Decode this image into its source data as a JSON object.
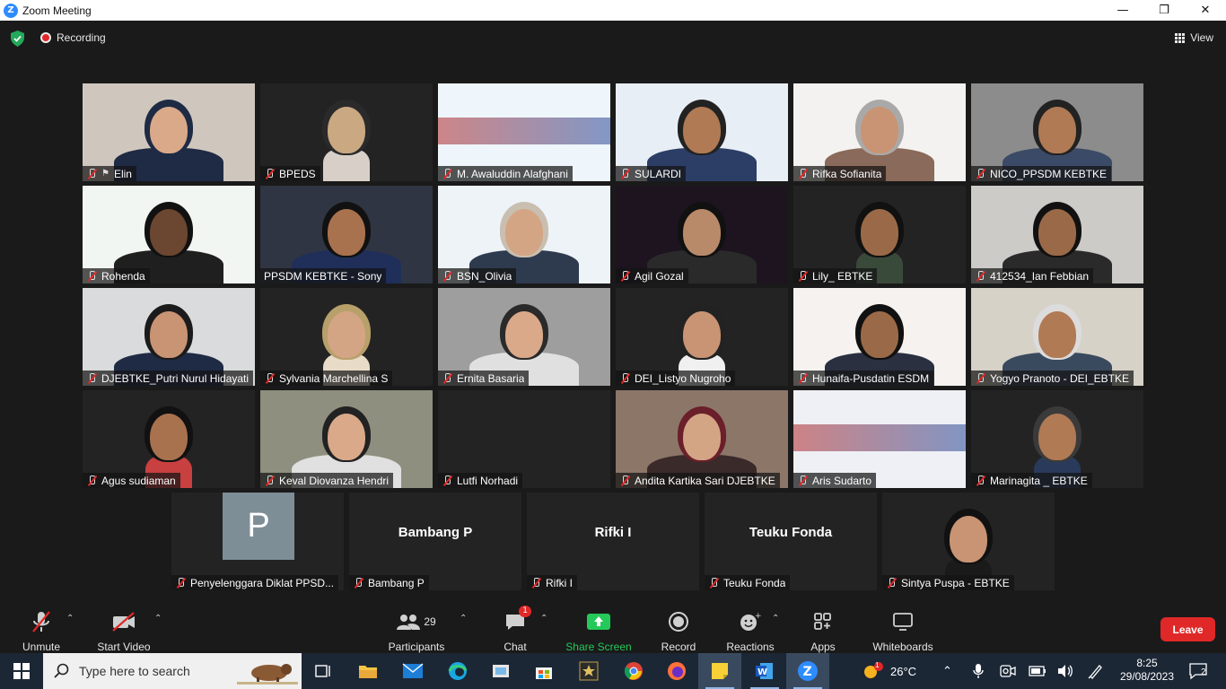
{
  "window": {
    "title": "Zoom Meeting"
  },
  "topbar": {
    "recording_label": "Recording",
    "view_label": "View"
  },
  "colors": {
    "accent_active": "#e4e45c",
    "leave": "#e02828",
    "share_green": "#25c95a",
    "zoom_blue": "#2d8cff"
  },
  "participants": [
    {
      "name": "Elin",
      "muted": true,
      "pinned": true
    },
    {
      "name": "BPEDS",
      "muted": true
    },
    {
      "name": "M. Awaluddin Alafghani",
      "muted": true
    },
    {
      "name": "SULARDI",
      "muted": true
    },
    {
      "name": "Rifka Sofianita",
      "muted": true
    },
    {
      "name": "NICO_PPSDM KEBTKE",
      "muted": true
    },
    {
      "name": "Rohenda",
      "muted": true
    },
    {
      "name": "PPSDM KEBTKE - Sony",
      "muted": false,
      "active_speaker": true
    },
    {
      "name": "BSN_Olivia",
      "muted": true
    },
    {
      "name": "Agil Gozal",
      "muted": true
    },
    {
      "name": "Lily_ EBTKE",
      "muted": true
    },
    {
      "name": "412534_Ian Febbian",
      "muted": true
    },
    {
      "name": "DJEBTKE_Putri Nurul Hidayati",
      "muted": true
    },
    {
      "name": "Sylvania Marchellina S",
      "muted": true
    },
    {
      "name": "Ernita Basaria",
      "muted": true
    },
    {
      "name": "DEI_Listyo Nugroho",
      "muted": true
    },
    {
      "name": "Hunaifa-Pusdatin ESDM",
      "muted": true
    },
    {
      "name": "Yogyo Pranoto - DEI_EBTKE",
      "muted": true
    },
    {
      "name": "Agus sudiaman",
      "muted": true
    },
    {
      "name": "Keval Diovanza Hendri",
      "muted": true
    },
    {
      "name": "Lutfi Norhadi",
      "muted": true
    },
    {
      "name": "Andita Kartika Sari DJEBTKE",
      "muted": true
    },
    {
      "name": "Aris Sudarto",
      "muted": true
    },
    {
      "name": "Marinagita _ EBTKE",
      "muted": true
    },
    {
      "name": "Penyelenggara Diklat PPSD...",
      "muted": true,
      "avatar_letter": "P"
    },
    {
      "name": "Bambang P",
      "muted": true,
      "center_name": "Bambang P"
    },
    {
      "name": "Rifki I",
      "muted": true,
      "center_name": "Rifki I"
    },
    {
      "name": "Teuku Fonda",
      "muted": true,
      "center_name": "Teuku Fonda"
    },
    {
      "name": "Sintya Puspa - EBTKE",
      "muted": true
    }
  ],
  "toolbar": {
    "unmute": "Unmute",
    "start_video": "Start Video",
    "participants": "Participants",
    "participants_count": "29",
    "chat": "Chat",
    "chat_badge": "1",
    "share_screen": "Share Screen",
    "record": "Record",
    "reactions": "Reactions",
    "apps": "Apps",
    "whiteboards": "Whiteboards",
    "leave": "Leave"
  },
  "taskbar": {
    "search_placeholder": "Type here to search",
    "weather_badge": "1",
    "temperature": "26°C",
    "time": "8:25",
    "date": "29/08/2023",
    "notification_count": "2"
  }
}
